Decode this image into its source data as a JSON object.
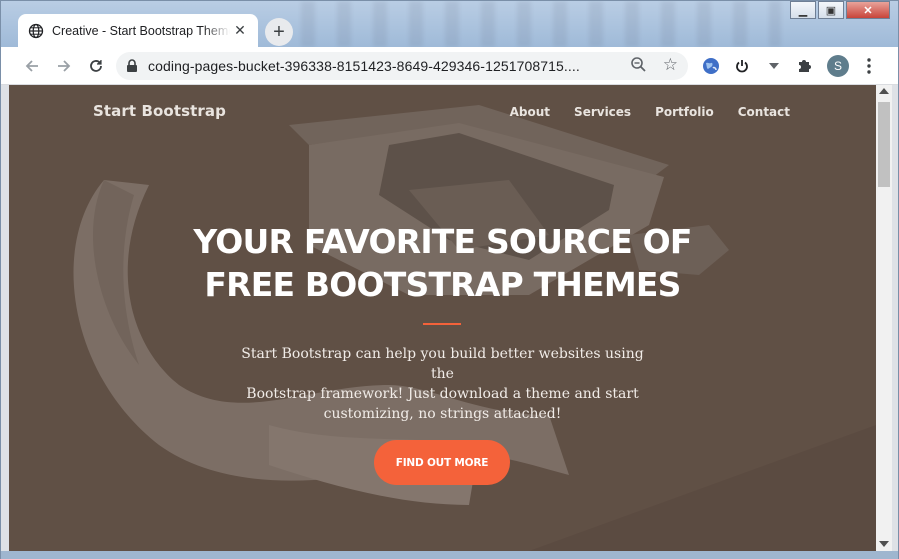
{
  "browser": {
    "tab_title": "Creative - Start Bootstrap Theme",
    "tab_close": "✕",
    "new_tab": "+",
    "url": "coding-pages-bucket-396338-8151423-8649-429346-1251708715....",
    "avatar_letter": "S",
    "window_controls": {
      "minimize": "▁",
      "restore": "▣",
      "close": "✕"
    }
  },
  "page": {
    "brand": "Start Bootstrap",
    "nav": [
      "About",
      "Services",
      "Portfolio",
      "Contact"
    ],
    "hero_title_line1": "YOUR FAVORITE SOURCE OF",
    "hero_title_line2": "FREE BOOTSTRAP THEMES",
    "hero_text_line1": "Start Bootstrap can help you build better websites using the",
    "hero_text_line2": "Bootstrap framework! Just download a theme and start",
    "hero_text_line3": "customizing, no strings attached!",
    "cta_label": "FIND OUT MORE",
    "accent_color": "#f4623a"
  }
}
